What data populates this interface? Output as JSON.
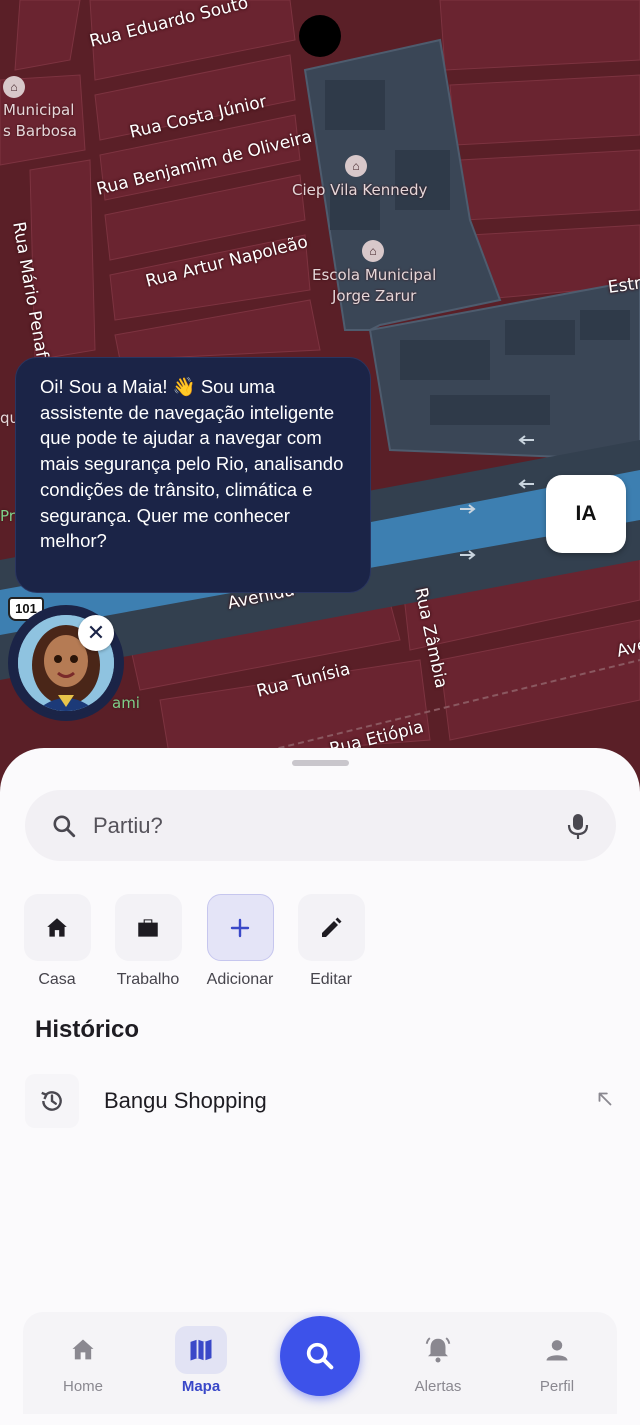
{
  "map": {
    "streets": [
      "Rua Eduardo Souto",
      "Rua Costa Júnior",
      "Rua Benjamim de Oliveira",
      "Rua Artur Napoleão",
      "Rua Mário Penaforte",
      "Rua Zâmbia",
      "Rua Tunísia",
      "Rua Etiópia",
      "Avenida",
      "Estr",
      "Ave"
    ],
    "pois": {
      "poi1_line1": "Municipal",
      "poi1_line2": "s Barbosa",
      "poi2": "Ciep Vila Kennedy",
      "poi3_line1": "Escola Municipal",
      "poi3_line2": "Jorge Zarur"
    },
    "route_shield": "101",
    "fragments": {
      "qu": "qu",
      "pra": "Pra",
      "ami": "ami"
    }
  },
  "assistant": {
    "message": "Oi! Sou a Maia! 👋 Sou uma assistente de navegação inteligente que pode te ajudar a navegar com mais segurança pelo Rio, analisando condições de trânsito, climática e segurança. Quer me conhecer melhor?",
    "ia_label": "IA",
    "close_symbol": "✕"
  },
  "search": {
    "placeholder": "Partiu?"
  },
  "shortcuts": [
    {
      "label": "Casa",
      "icon": "home-icon"
    },
    {
      "label": "Trabalho",
      "icon": "briefcase-icon"
    },
    {
      "label": "Adicionar",
      "icon": "plus-icon"
    },
    {
      "label": "Editar",
      "icon": "pencil-icon"
    }
  ],
  "history": {
    "title": "Histórico",
    "items": [
      {
        "label": "Bangu Shopping",
        "icon": "history-icon"
      }
    ]
  },
  "nav": {
    "items": [
      {
        "label": "Home",
        "icon": "home-icon"
      },
      {
        "label": "Mapa",
        "icon": "map-icon",
        "active": true
      },
      {
        "label": "Alertas",
        "icon": "bell-icon"
      },
      {
        "label": "Perfil",
        "icon": "person-icon"
      }
    ],
    "fab_icon": "search-icon"
  },
  "colors": {
    "map_zone": "#5a1f27",
    "safe_zone": "#3a4656",
    "river": "#3d7fb1",
    "accent": "#3d52ea",
    "bubble": "#1b2447"
  }
}
